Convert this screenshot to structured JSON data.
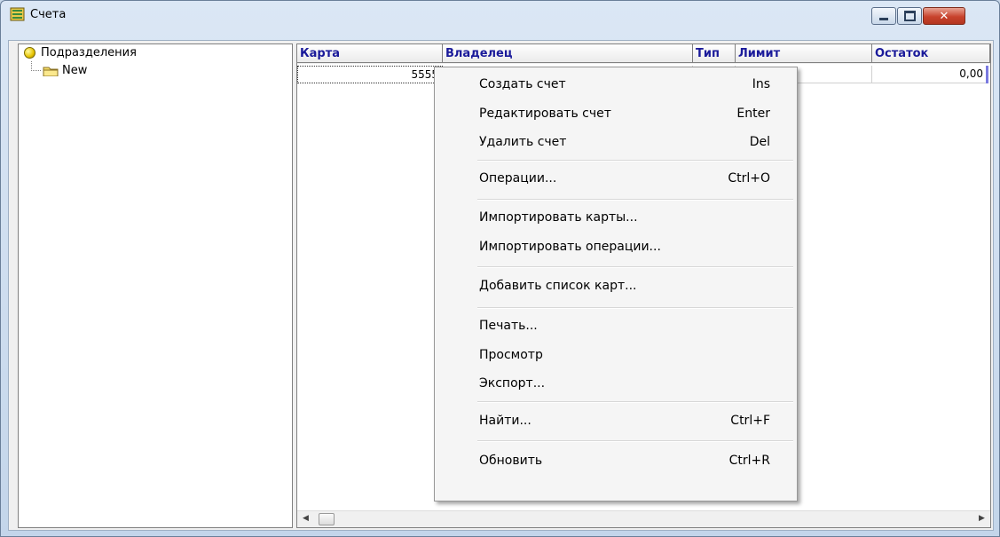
{
  "window": {
    "title": "Счета",
    "icon": "accounts-book-icon",
    "controls": {
      "minimize": "minimize-icon",
      "maximize": "maximize-icon",
      "close": "✕"
    }
  },
  "tree": {
    "root_label": "Подразделения",
    "root_icon": "yellow-bulb-icon",
    "child_label": "New",
    "child_icon": "folder-icon"
  },
  "grid": {
    "columns": [
      "Карта",
      "Владелец",
      "Тип",
      "Лимит",
      "Остаток"
    ],
    "header_color": "#1a1a9a",
    "rows": [
      {
        "card": "5555",
        "owner": "",
        "type": "",
        "limit": "",
        "balance": "0,00"
      }
    ]
  },
  "scrollbar": {
    "left_arrow": "◀",
    "right_arrow": "▶"
  },
  "context_menu": {
    "items": [
      {
        "label": "Создать счет",
        "shortcut": "Ins"
      },
      {
        "label": "Редактировать счет",
        "shortcut": "Enter"
      },
      {
        "label": "Удалить счет",
        "shortcut": "Del"
      },
      {
        "label": "Операции...",
        "shortcut": "Ctrl+O"
      },
      {
        "label": "Импортировать карты...",
        "shortcut": ""
      },
      {
        "label": "Импортировать операции...",
        "shortcut": ""
      },
      {
        "label": "Добавить список карт...",
        "shortcut": ""
      },
      {
        "label": "Печать...",
        "shortcut": ""
      },
      {
        "label": "Просмотр",
        "shortcut": ""
      },
      {
        "label": "Экспорт...",
        "shortcut": ""
      },
      {
        "label": "Найти...",
        "shortcut": "Ctrl+F"
      },
      {
        "label": "Обновить",
        "shortcut": "Ctrl+R"
      }
    ]
  }
}
